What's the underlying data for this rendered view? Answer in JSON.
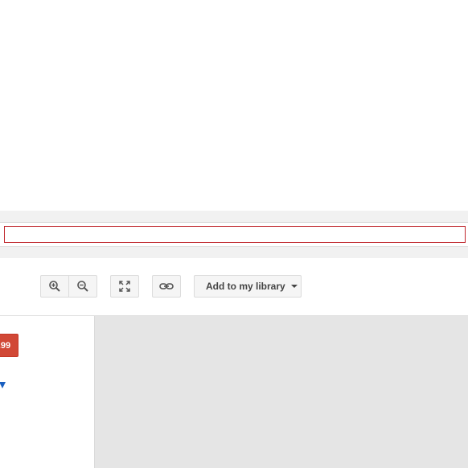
{
  "search": {
    "value": "",
    "placeholder": ""
  },
  "toolbar": {
    "zoom_in_icon": "zoom-in-icon",
    "zoom_out_icon": "zoom-out-icon",
    "fullscreen_icon": "fullscreen-icon",
    "link_icon": "link-icon",
    "add_to_library_label": "Add to my library"
  },
  "sidebar": {
    "price_label": ".99"
  },
  "colors": {
    "accent_red": "#d14836",
    "input_border": "#c0262c",
    "link_blue": "#1a5fc0",
    "viewer_background": "#e5e5e5",
    "band_gray": "#f1f1f1"
  }
}
